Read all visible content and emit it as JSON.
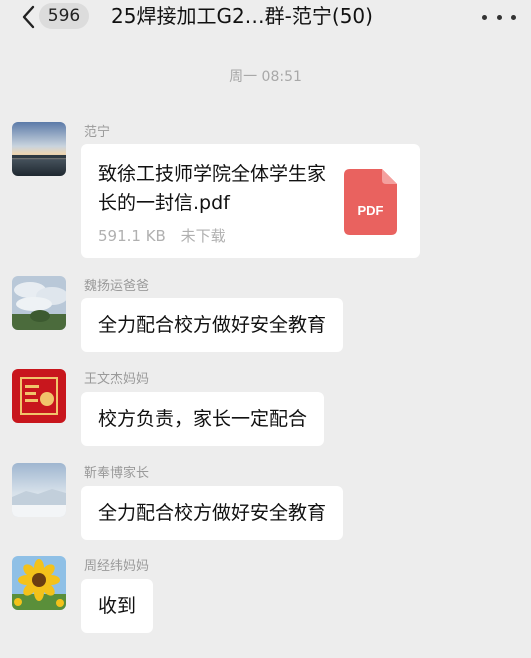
{
  "header": {
    "unread_count": "596",
    "title": "25焊接加工G2…群-范宁(50)"
  },
  "timestamp": "周一 08:51",
  "messages": [
    {
      "sender": "范宁",
      "type": "file",
      "file_name": "致徐工技师学院全体学生家长的一封信.pdf",
      "file_size": "591.1 KB",
      "file_status": "未下载",
      "file_type_label": "PDF"
    },
    {
      "sender": "魏扬运爸爸",
      "text": "全力配合校方做好安全教育"
    },
    {
      "sender": "王文杰妈妈",
      "text": "校方负责，家长一定配合"
    },
    {
      "sender": "靳奉博家长",
      "text": "全力配合校方做好安全教育"
    },
    {
      "sender": "周经纬妈妈",
      "text": "收到"
    }
  ],
  "icons": {
    "back": "chevron-left-icon",
    "more": "more-dots-icon",
    "file": "pdf-file-icon"
  },
  "colors": {
    "background": "#ededed",
    "bubble": "#ffffff",
    "pdf": "#e9625f",
    "meta_text": "#a8a8a8"
  }
}
